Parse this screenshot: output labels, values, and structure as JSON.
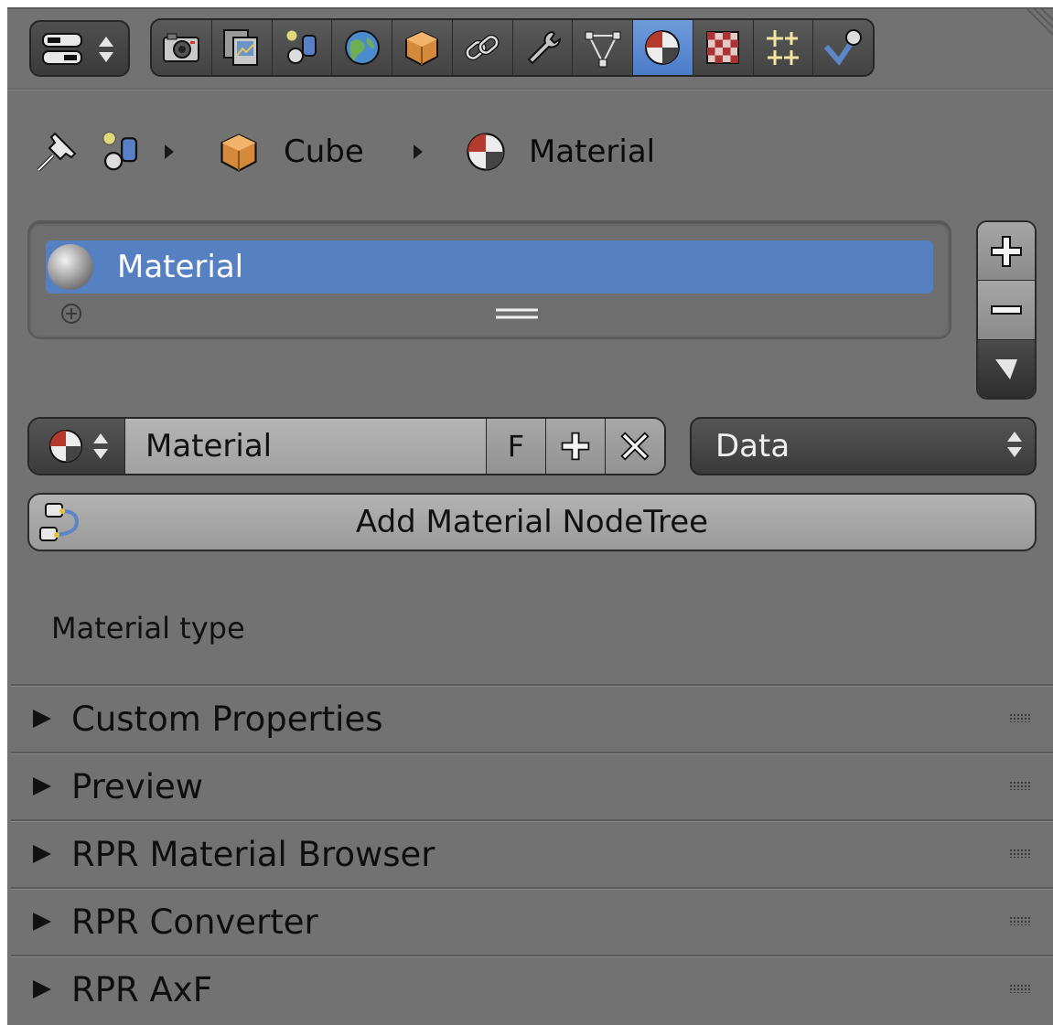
{
  "header": {
    "editor_type_icon": "properties-editor-icon",
    "context_tabs": [
      {
        "icon": "render-camera-icon",
        "active": false
      },
      {
        "icon": "render-layers-icon",
        "active": false
      },
      {
        "icon": "scene-icon",
        "active": false
      },
      {
        "icon": "world-icon",
        "active": false
      },
      {
        "icon": "object-cube-icon",
        "active": false
      },
      {
        "icon": "constraints-link-icon",
        "active": false
      },
      {
        "icon": "modifiers-wrench-icon",
        "active": false
      },
      {
        "icon": "object-data-mesh-icon",
        "active": false
      },
      {
        "icon": "material-icon",
        "active": true
      },
      {
        "icon": "texture-checker-icon",
        "active": false
      },
      {
        "icon": "particles-icon",
        "active": false
      },
      {
        "icon": "physics-icon",
        "active": false
      }
    ]
  },
  "breadcrumb": {
    "object": "Cube",
    "material": "Material"
  },
  "slots": {
    "items": [
      {
        "label": "Material",
        "selected": true
      }
    ]
  },
  "material_id": {
    "name": "Material",
    "fake_user_label": "F",
    "link": "Data"
  },
  "add_nodetree_label": "Add Material NodeTree",
  "material_type_label": "Material type",
  "panels": [
    {
      "title": "Custom Properties"
    },
    {
      "title": "Preview"
    },
    {
      "title": "RPR Material Browser"
    },
    {
      "title": "RPR Converter"
    },
    {
      "title": "RPR AxF"
    }
  ],
  "colors": {
    "panel_bg": "#727272",
    "selection": "#5680c2",
    "active_tab": "#5e8bd1"
  }
}
